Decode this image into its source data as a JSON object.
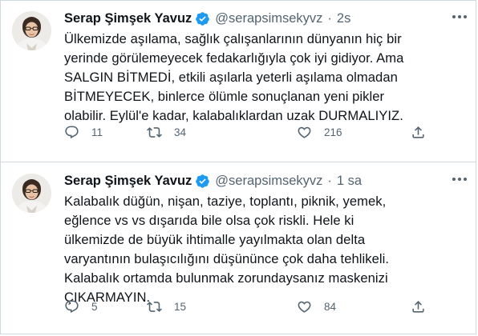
{
  "tweets": [
    {
      "author_name": "Serap Şimşek Yavuz",
      "handle": "@serapsimsekyvz",
      "separator": "·",
      "time": "2s",
      "lines": [
        "Ülkemizde aşılama, sağlık çalışanlarının dünyanın hiç bir",
        "yerinde görülemeyecek fedakarlığıyla çok iyi gidiyor. Ama",
        "SALGIN BİTMEDİ, etkili aşılarla yeterli aşılama olmadan",
        "BİTMEYECEK, binlerce ölümle sonuçlanan yeni pikler",
        "olabilir. Eylül'e kadar, kalabalıklardan uzak DURMALIYIZ."
      ],
      "replies": "11",
      "retweets": "34",
      "likes": "216"
    },
    {
      "author_name": "Serap Şimşek Yavuz",
      "handle": "@serapsimsekyvz",
      "separator": "·",
      "time": "1 sa",
      "lines": [
        "Kalabalık düğün, nişan, taziye, toplantı, piknik, yemek,",
        "eğlence vs vs dışarıda bile olsa çok riskli. Hele ki",
        "ülkemizde de büyük ihtimalle yayılmakta olan delta",
        "varyantının bulaşıcılığını düşününce çok daha tehlikeli.",
        "Kalabalık ortamda bulunmak zorundaysanız maskenizi",
        "ÇIKARMAYIN."
      ],
      "replies": "5",
      "retweets": "15",
      "likes": "84"
    }
  ],
  "colors": {
    "text": "#0f1419",
    "secondary": "#536471",
    "verified": "#1d9bf0",
    "border": "#cfd9de"
  }
}
